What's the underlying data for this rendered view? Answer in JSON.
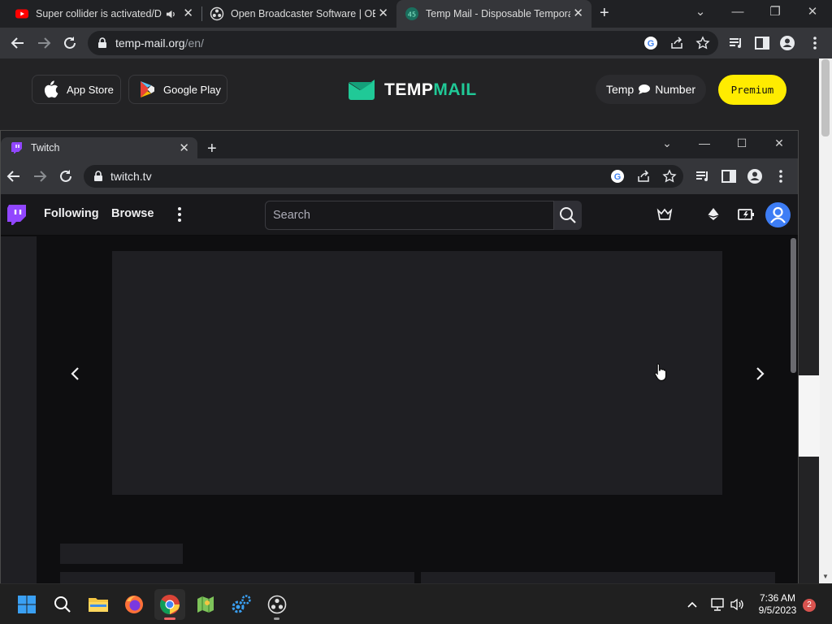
{
  "back_browser": {
    "tabs": [
      {
        "title": "Super collider is activated/De",
        "icon": "youtube-icon",
        "audio": true
      },
      {
        "title": "Open Broadcaster Software | OBS",
        "icon": "obs-icon"
      },
      {
        "title": "Temp Mail - Disposable Tempora",
        "icon": "tempmail-icon",
        "active": true
      }
    ],
    "url_host": "temp-mail.org",
    "url_path": "/en/"
  },
  "tempmail_page": {
    "app_store_label": "App Store",
    "google_play_label": "Google Play",
    "logo_part1": "TEMP",
    "logo_part2": "MAIL",
    "temp_label": "Temp",
    "number_label": "Number",
    "premium_label": "Premium",
    "colors": {
      "accent": "#20c997",
      "premium_bg": "#ffec00"
    }
  },
  "front_browser": {
    "tab_title": "Twitch",
    "url": "twitch.tv"
  },
  "twitch": {
    "nav": {
      "following": "Following",
      "browse": "Browse"
    },
    "search_placeholder": "Search",
    "colors": {
      "brand": "#9146ff",
      "avatar": "#3d7df5"
    }
  },
  "taskbar": {
    "time": "7:36 AM",
    "date": "9/5/2023",
    "notification_count": "2",
    "apps": [
      "windows-start-icon",
      "search-icon",
      "file-explorer-icon",
      "firefox-icon",
      "chrome-icon",
      "maps-app-icon",
      "settings-gears-icon",
      "obs-icon"
    ]
  }
}
